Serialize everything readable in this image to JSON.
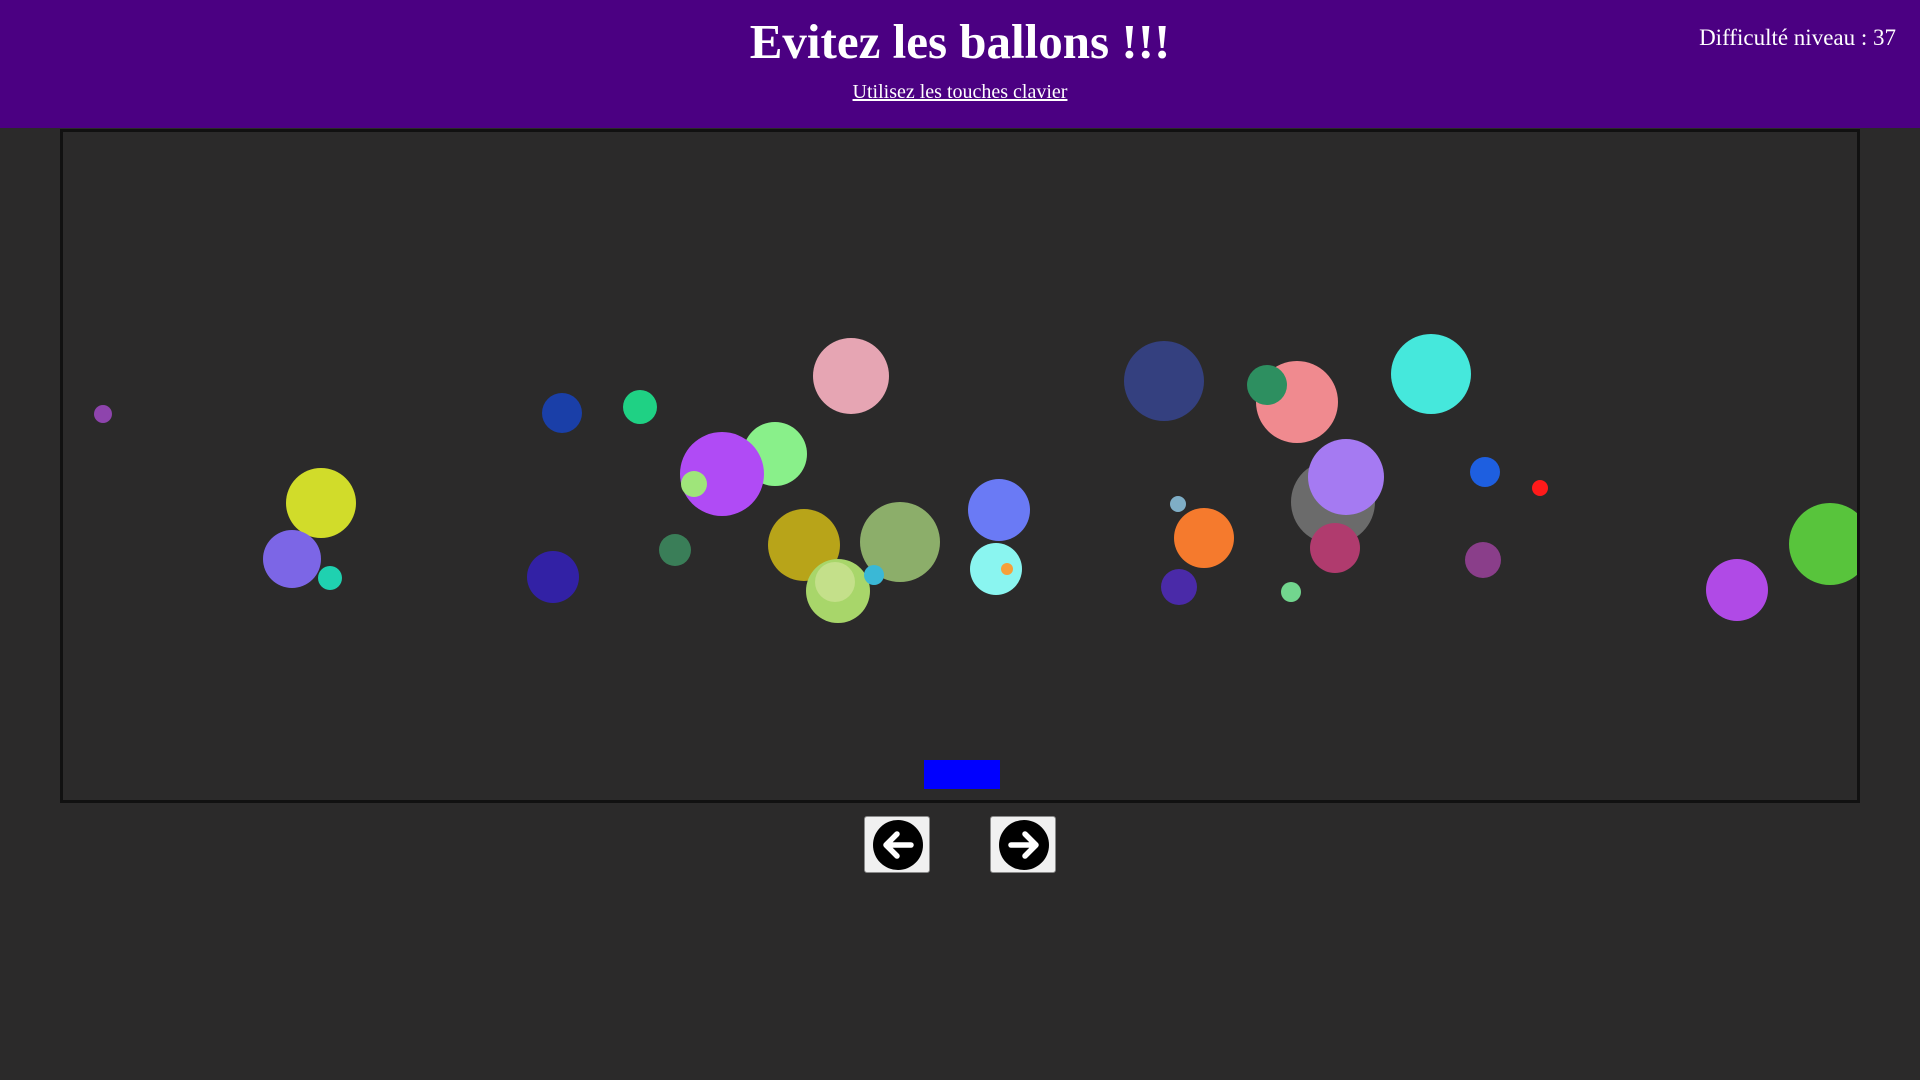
{
  "header": {
    "title": "Evitez les ballons !!!",
    "subtitle": "Utilisez les touches clavier",
    "difficulty": "Difficulté niveau : 37"
  },
  "colors": {
    "header_bg": "#4b0082",
    "page_bg": "#2b2a2a",
    "player": "#0000ff"
  },
  "controls": {
    "left_icon": "arrow-left-circle-icon",
    "right_icon": "arrow-right-circle-icon"
  },
  "game": {
    "balloon_colors": [
      "#8e44ad",
      "#1a3fa8",
      "#1fd184",
      "#e6a5b3",
      "#89f08a",
      "#b04bf5",
      "#9fe57a",
      "#34407f",
      "#2d8f60",
      "#f08a8f",
      "#45e8dc",
      "#a57af2",
      "#6b6b6b",
      "#1e5fe0",
      "#ff1a1a",
      "#d1dc2a",
      "#7c66e6",
      "#1fd1b0",
      "#3221a5",
      "#3a7e58",
      "#b8a419",
      "#8cae6a",
      "#a8d66a",
      "#c4e08a",
      "#3ab8d6",
      "#6a7af5",
      "#8af5f0",
      "#f7a03a",
      "#7faec6",
      "#f57a2d",
      "#4a2aa8",
      "#b03b6e",
      "#72d68e",
      "#8a3e8a",
      "#b04ae6",
      "#58c43c"
    ]
  }
}
